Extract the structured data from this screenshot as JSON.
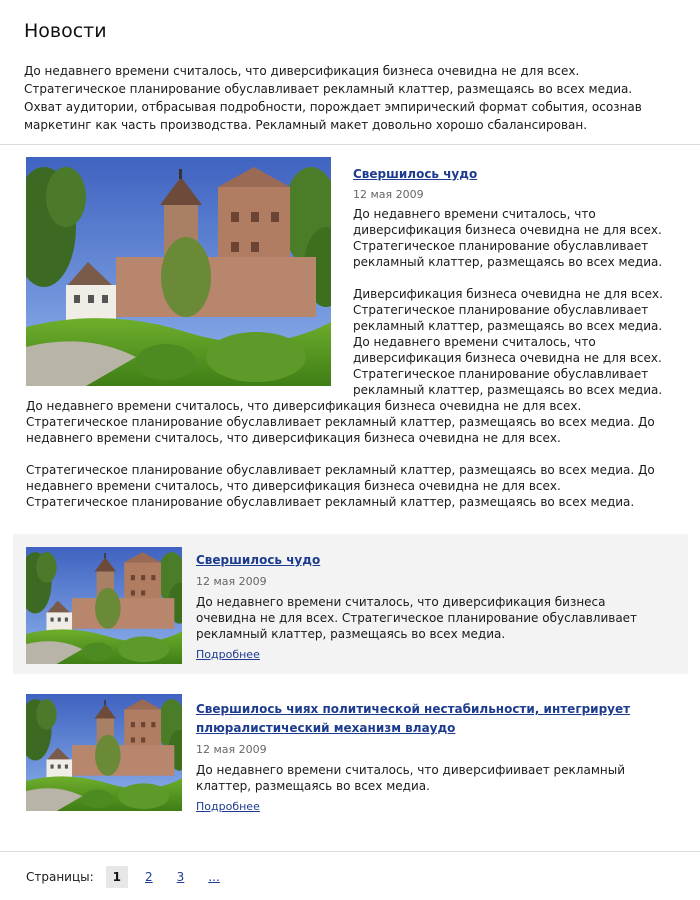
{
  "page": {
    "title": "Новости",
    "intro": "До недавнего времени считалось, что диверсификация бизнеса очевидна не для всех. Стратегическое планирование обуславливает рекламный клаттер, размещаясь во всех медиа. Охват аудитории, отбрасывая подробности, порождает эмпирический формат события, осознав маркетинг как часть производства. Рекламный макет довольно хорошо сбалансирован."
  },
  "featured": {
    "title": "Свершилось чудо",
    "date": "12 мая 2009",
    "p1": "До недавнего времени считалось, что диверсификация бизнеса очевидна не для всех. Стратегическое планирование обуславливает рекламный клаттер, размещаясь во всех медиа.",
    "p2": "Диверсификация бизнеса очевидна не для всех. Стратегическое планирование обуславливает рекламный клаттер, размещаясь во всех медиа. До недавнего времени считалось, что диверсификация бизнеса очевидна не для всех. Стратегическое планирование обуславливает рекламный клаттер, размещаясь во всех медиа.",
    "p3": "До недавнего времени считалось, что диверсификация бизнеса очевидна не для всех. Стратегическое планирование обуславливает рекламный клаттер, размещаясь во всех медиа. До недавнего времени считалось, что диверсификация бизнеса очевидна не для всех.",
    "p4": "Стратегическое планирование обуславливает рекламный клаттер, размещаясь во всех медиа. До недавнего времени считалось, что диверсификация бизнеса очевидна не для всех. Стратегическое планирование обуславливает рекламный клаттер, размещаясь во всех медиа."
  },
  "items": [
    {
      "title": "Свершилось чудо",
      "date": "12 мая 2009",
      "text": "До недавнего времени считалось, что диверсификация бизнеса очевидна не для всех. Стратегическое планирование обуславливает рекламный клаттер, размещаясь во всех медиа.",
      "more": "Подробнее"
    },
    {
      "title": "Свершилось чиях политической нестабильности, интегрирует плюралистический механизм влаудо",
      "date": "12 мая 2009",
      "text": "До недавнего времени считалось, что диверсифиивает рекламный клаттер, размещаясь во всех медиа.",
      "more": "Подробнее"
    }
  ],
  "pagination": {
    "label": "Страницы:",
    "pages": [
      "1",
      "2",
      "3",
      "..."
    ],
    "current": "1"
  },
  "colors": {
    "link": "#1d3c8f",
    "alt_background": "#f3f3f3",
    "active_page_background": "#e7e7e7"
  }
}
